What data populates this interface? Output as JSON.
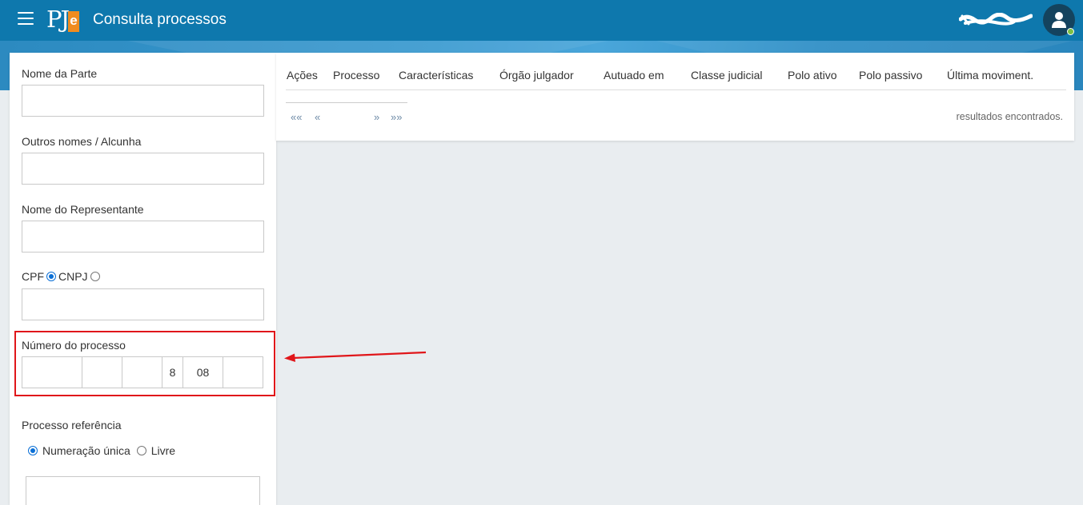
{
  "header": {
    "title": "Consulta processos",
    "logo_text": "PJ",
    "logo_e": "e",
    "menu_icon": "hamburger-icon",
    "user_icon": "user-icon",
    "colors": {
      "bar": "#0e78ad",
      "logo_accent": "#f08c1f",
      "status": "#7bc043"
    }
  },
  "filters": {
    "nome_parte_label": "Nome da Parte",
    "outros_nomes_label": "Outros nomes / Alcunha",
    "representante_label": "Nome do Representante",
    "cpf_label": "CPF",
    "cnpj_label": "CNPJ",
    "numero_processo_label": "Número do processo",
    "numero_segments": [
      "",
      "",
      "",
      "8",
      "08",
      ""
    ],
    "processo_referencia_label": "Processo referência",
    "numeracao_unica_label": "Numeração única",
    "livre_label": "Livre"
  },
  "results": {
    "columns": [
      "Ações",
      "Processo",
      "Características",
      "Órgão julgador",
      "Autuado em",
      "Classe judicial",
      "Polo ativo",
      "Polo passivo",
      "Última moviment."
    ],
    "pager": {
      "first": "««",
      "prev": "«",
      "next": "»",
      "last": "»»"
    },
    "count_text": "resultados encontrados."
  },
  "annotation": {
    "color": "#e0161a"
  }
}
